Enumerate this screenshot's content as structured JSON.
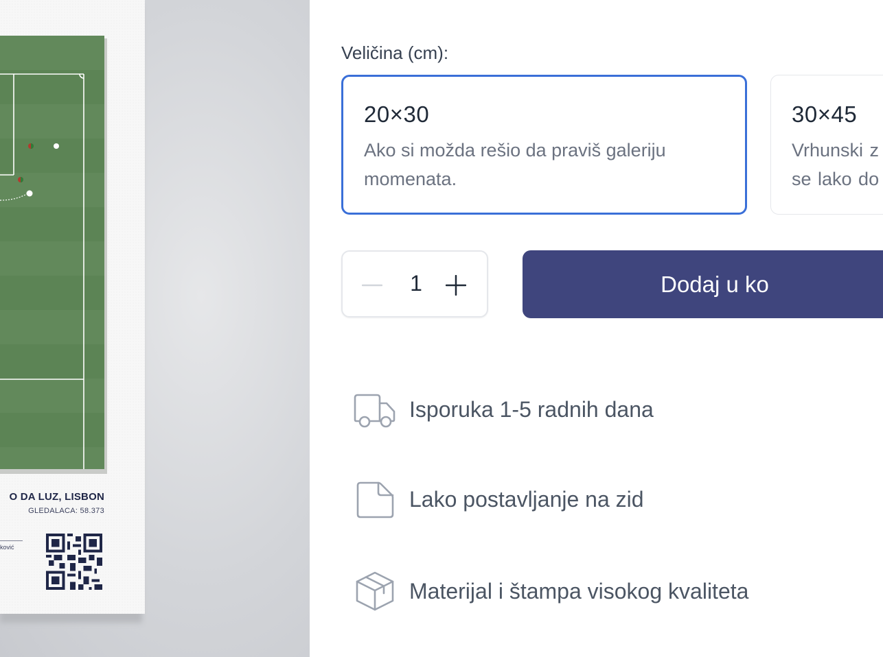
{
  "poster": {
    "venue": "O DA LUZ, LISBON",
    "attendance": "GLEDALACA: 58.373",
    "author": "ković"
  },
  "size_selector": {
    "label": "Veličina (cm):",
    "options": [
      {
        "title": "20×30",
        "description": "Ako si možda rešio da praviš galeriju momenata.",
        "selected": true
      },
      {
        "title": "30×45",
        "description": "Vrhunski z se lako do",
        "selected": false
      }
    ]
  },
  "quantity": {
    "value": "1"
  },
  "cart": {
    "button_label": "Dodaj u ko"
  },
  "features": [
    {
      "icon": "truck-icon",
      "label": "Isporuka 1-5 radnih dana"
    },
    {
      "icon": "document-icon",
      "label": "Lako postavljanje na zid"
    },
    {
      "icon": "box-icon",
      "label": "Materijal i štampa visokog kvaliteta"
    }
  ],
  "colors": {
    "accent": "#3a6fd8",
    "button": "#3f457d",
    "text": "#374151",
    "muted": "#6b7280",
    "pitch_green": "#62895b"
  }
}
